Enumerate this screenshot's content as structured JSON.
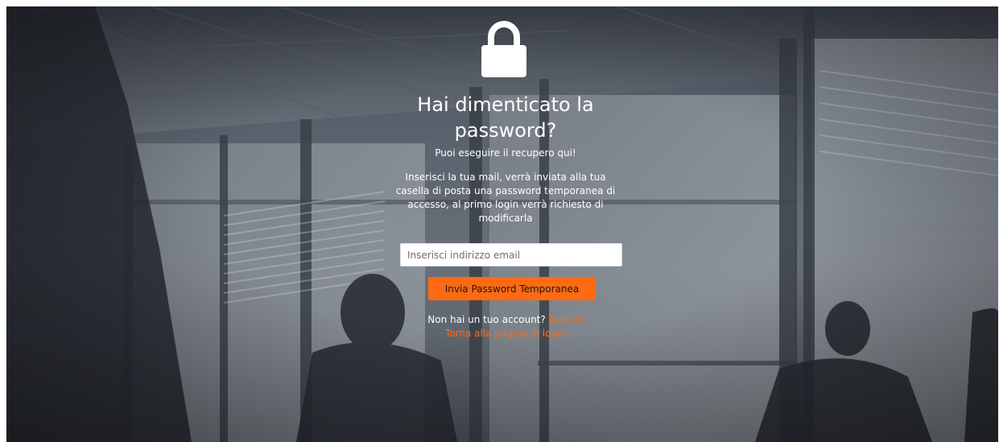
{
  "page": {
    "title": "Hai dimenticato la password?",
    "subtitle": "Puoi eseguire il recupero qui!",
    "description": "Inserisci la tua mail, verrà inviata alla tua casella di posta una password temporanea di accesso, al primo login verrà richiesto di modificarla"
  },
  "form": {
    "email_placeholder": "Inserisci indirizzo email",
    "email_value": "",
    "submit_label": "Invia Password Temporanea"
  },
  "footer": {
    "no_account_text": "Non hai un tuo account?",
    "signup_link": "Iscriviti",
    "back_to_login_link": "Torna alla pagina di login"
  },
  "icons": {
    "lock": "lock-icon"
  },
  "colors": {
    "accent": "#ff6a13",
    "text": "#ffffff",
    "background": "#5d6570"
  }
}
